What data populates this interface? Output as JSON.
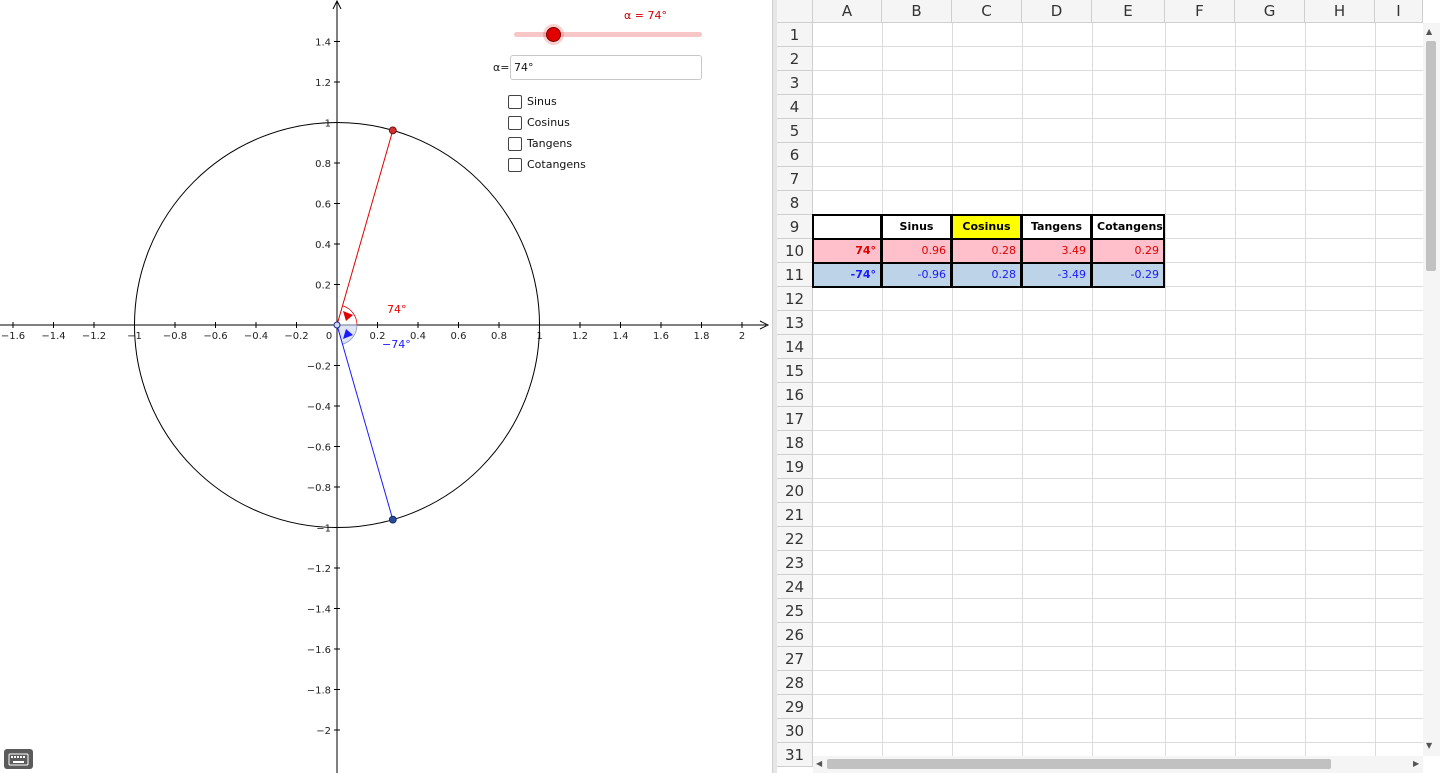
{
  "graphics": {
    "slider": {
      "label": "α = 74°",
      "min": 0,
      "max": 360,
      "value": 74,
      "color": "#d10000"
    },
    "input": {
      "label": "α=",
      "value": "74°"
    },
    "checkboxes": [
      {
        "label": "Sinus",
        "checked": false
      },
      {
        "label": "Cosinus",
        "checked": false
      },
      {
        "label": "Tangens",
        "checked": false
      },
      {
        "label": "Cotangens",
        "checked": false
      }
    ],
    "plot": {
      "x_ticks": [
        "−1.6",
        "−1.4",
        "−1.2",
        "−1",
        "−0.8",
        "−0.6",
        "−0.4",
        "−0.2",
        "0",
        "0.2",
        "0.4",
        "0.6",
        "0.8",
        "1",
        "1.2",
        "1.4",
        "1.6",
        "1.8",
        "2"
      ],
      "y_ticks_pos": [
        "0.2",
        "0.4",
        "0.6",
        "0.8",
        "1",
        "1.2",
        "1.4"
      ],
      "y_ticks_neg": [
        "−0.2",
        "−0.4",
        "−0.6",
        "−0.8",
        "−1",
        "−1.2",
        "−1.4",
        "−1.6",
        "−1.8",
        "−2"
      ],
      "angle_positive_label": "74°",
      "angle_negative_label": "−74°",
      "angle_deg": 74,
      "positive_color": "#e00000",
      "negative_color": "#1a1aff"
    },
    "keyboard_icon": "keyboard-icon"
  },
  "spreadsheet": {
    "columns": [
      "A",
      "B",
      "C",
      "D",
      "E",
      "F",
      "G",
      "H",
      "I"
    ],
    "rows": [
      "1",
      "2",
      "3",
      "4",
      "5",
      "6",
      "7",
      "8",
      "9",
      "10",
      "11",
      "12",
      "13",
      "14",
      "15",
      "16",
      "17",
      "18",
      "19",
      "20",
      "21",
      "22",
      "23",
      "24",
      "25",
      "26",
      "27",
      "28",
      "29",
      "30",
      "31"
    ],
    "table": {
      "headers": [
        "",
        "Sinus",
        "Cosinus",
        "Tangens",
        "Cotangens"
      ],
      "row_pos": {
        "angle": "74°",
        "sin": "0.96",
        "cos": "0.28",
        "tan": "3.49",
        "cot": "0.29"
      },
      "row_neg": {
        "angle": "-74°",
        "sin": "-0.96",
        "cos": "0.28",
        "tan": "-3.49",
        "cot": "-0.29"
      },
      "highlight_header_color": "#ffff00",
      "row_pos_bg": "#ffc0cb",
      "row_neg_bg": "#bdd3e8"
    }
  }
}
